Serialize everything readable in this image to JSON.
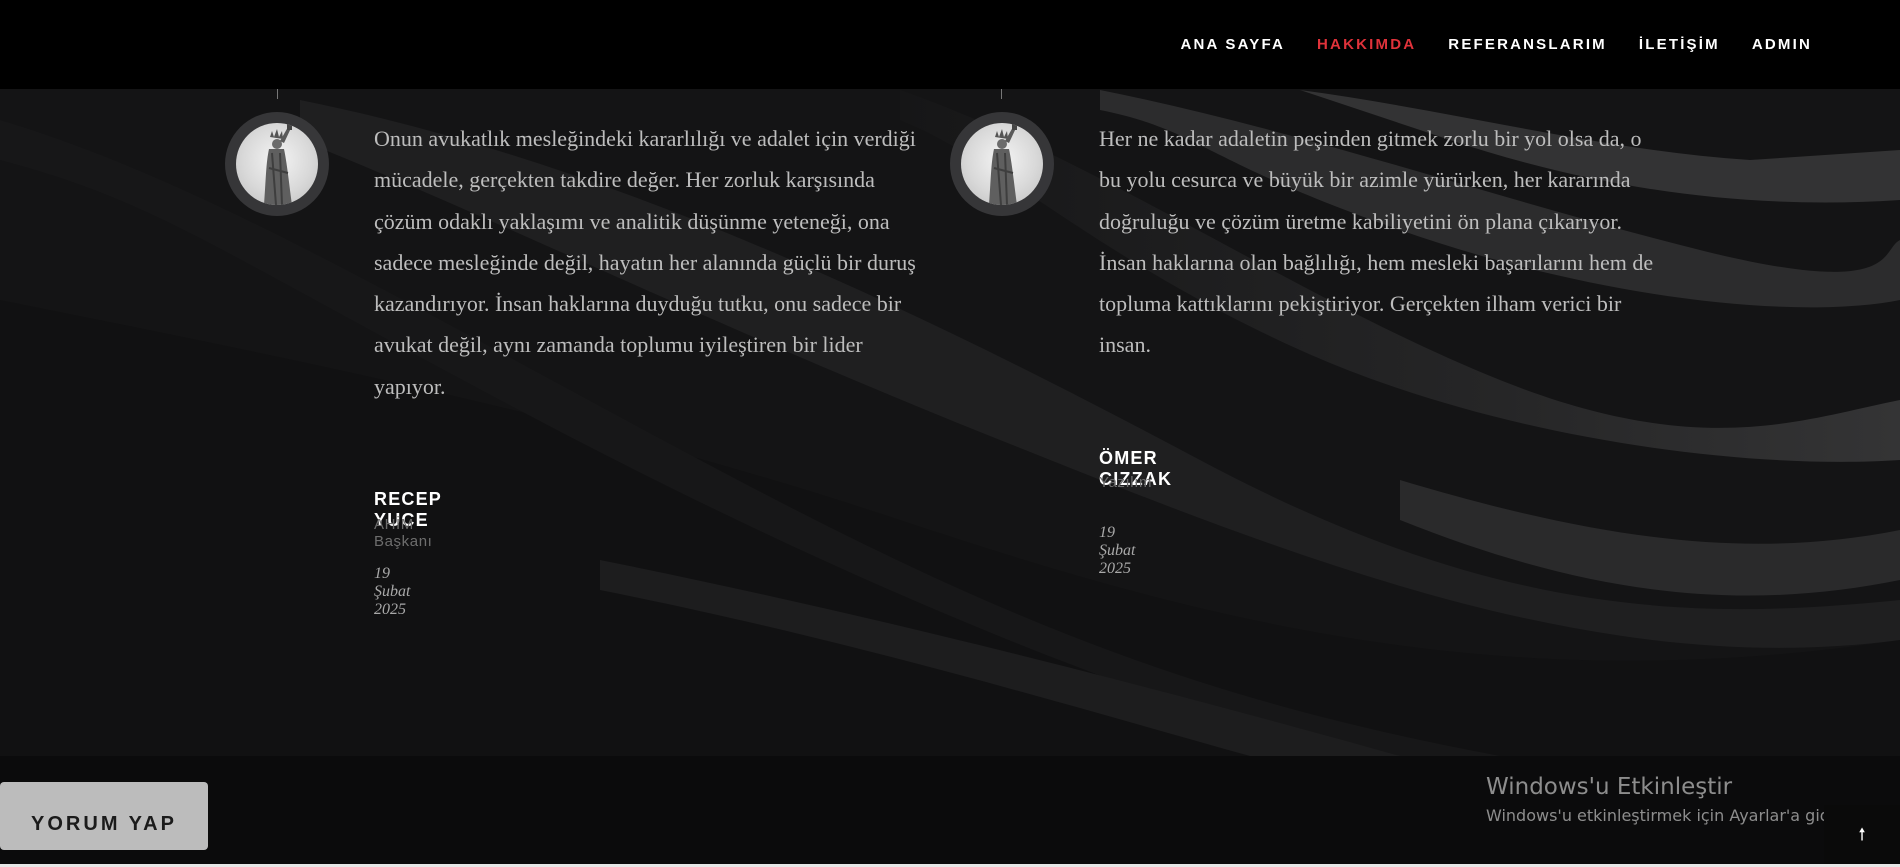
{
  "nav": {
    "items": [
      {
        "label": "ANA SAYFA",
        "active": false
      },
      {
        "label": "HAKKIMDA",
        "active": true
      },
      {
        "label": "REFERANSLARIM",
        "active": false
      },
      {
        "label": "İLETİŞİM",
        "active": false
      },
      {
        "label": "ADMIN",
        "active": false
      }
    ],
    "active_color": "#e0323a"
  },
  "testimonials": [
    {
      "quote": "Onun avukatlık mesleğindeki kararlılığı ve adalet için verdiği mücadele, gerçekten takdire değer. Her zorluk karşısında çözüm odaklı yaklaşımı ve analitik düşünme yeteneği, ona sadece mesleğinde değil, hayatın her alanında güçlü bir duruş kazandırıyor. İnsan haklarına duyduğu tutku, onu sadece bir avukat değil, aynı zamanda toplumu iyileştiren bir lider yapıyor.",
      "name": "RECEP YUCE",
      "role": "AHİM Başkanı",
      "date": "19 Şubat 2025",
      "avatar_icon": "statue-of-liberty-icon"
    },
    {
      "quote": "Her ne kadar adaletin peşinden gitmek zorlu bir yol olsa da, o bu yolu cesurca ve büyük bir azimle yürürken, her kararında doğruluğu ve çözüm üretme kabiliyetini ön plana çıkarıyor. İnsan haklarına olan bağlılığı, hem mesleki başarılarını hem de topluma kattıklarını pekiştiriyor. Gerçekten ilham verici bir insan.",
      "name": "ÖMER CIZZAK",
      "role": "Yazılım",
      "date": "19 Şubat 2025",
      "avatar_icon": "statue-of-liberty-icon"
    }
  ],
  "comment_button": {
    "label": "YORUM YAP"
  },
  "windows_activation": {
    "title": "Windows'u Etkinleştir",
    "subtitle": "Windows'u etkinleştirmek için Ayarlar'a gidin."
  },
  "scroll_top": {
    "icon": "arrow-up-icon",
    "glyph": "🠕"
  }
}
